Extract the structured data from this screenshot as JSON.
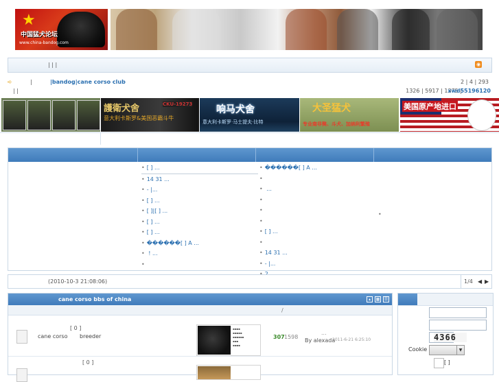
{
  "header": {
    "logo_cn": "中国猛犬论坛",
    "logo_url": "www.china-bandog.com"
  },
  "nav": {
    "separators": "|  |  |"
  },
  "info": {
    "link_text": "|bandog|cane corso club",
    "stats_top": "2  |   4  |   293",
    "stats_bottom": "1326  |   5917  |   1375  |",
    "stats_user": "xwd55196120",
    "left_seps": "|   |"
  },
  "ads": {
    "ad2_title": "護衛犬舍",
    "ad2_badge": "CKU-19273",
    "ad2_sub": "意大利卡斯罗&美国恶霸斗牛",
    "ad3_title": "响马犬舍",
    "ad3_sub": "意大利卡斯罗·马士提夫·比特",
    "ad4_title": "大圣猛犬",
    "ad4_sub": "专业南非獒、斗犬、加纳利繁殖",
    "ad5_title": "美国原产地进口"
  },
  "grid": {
    "col2": [
      "[ ]      ...",
      "14      31   ...",
      "-      |...",
      "[ ]      ...",
      "[ ]|[ ]      ...",
      "[ ]      ...",
      "[ ]      ...",
      "������[ ] A   ...",
      "      !    ...",
      ""
    ],
    "col3": [
      "������[ ] A   ...",
      "",
      "      ...",
      "",
      "",
      "",
      "[ ]      ...",
      "",
      "14      31   ...",
      "-      |...",
      "2"
    ],
    "col4_dot": "•"
  },
  "status": {
    "time": "(2010-10-3 21:08:06)",
    "page": "1/4",
    "prev": "◀",
    "next": "▶"
  },
  "forum": {
    "title": "cane corso bbs of china",
    "sub_sep": "/",
    "row1": {
      "bracket": "[   0 ]",
      "name": "cane corso",
      "breeder": "breeder",
      "dots": "...",
      "posts": "307",
      "replies": "1598",
      "by": "By alexada",
      "date": "2011-6-21 6:25:10"
    },
    "row2": {
      "bracket": "[   0 ]"
    }
  },
  "login": {
    "captcha": "4366",
    "cookie_label": "Cookie",
    "brackets": "[   ]"
  }
}
